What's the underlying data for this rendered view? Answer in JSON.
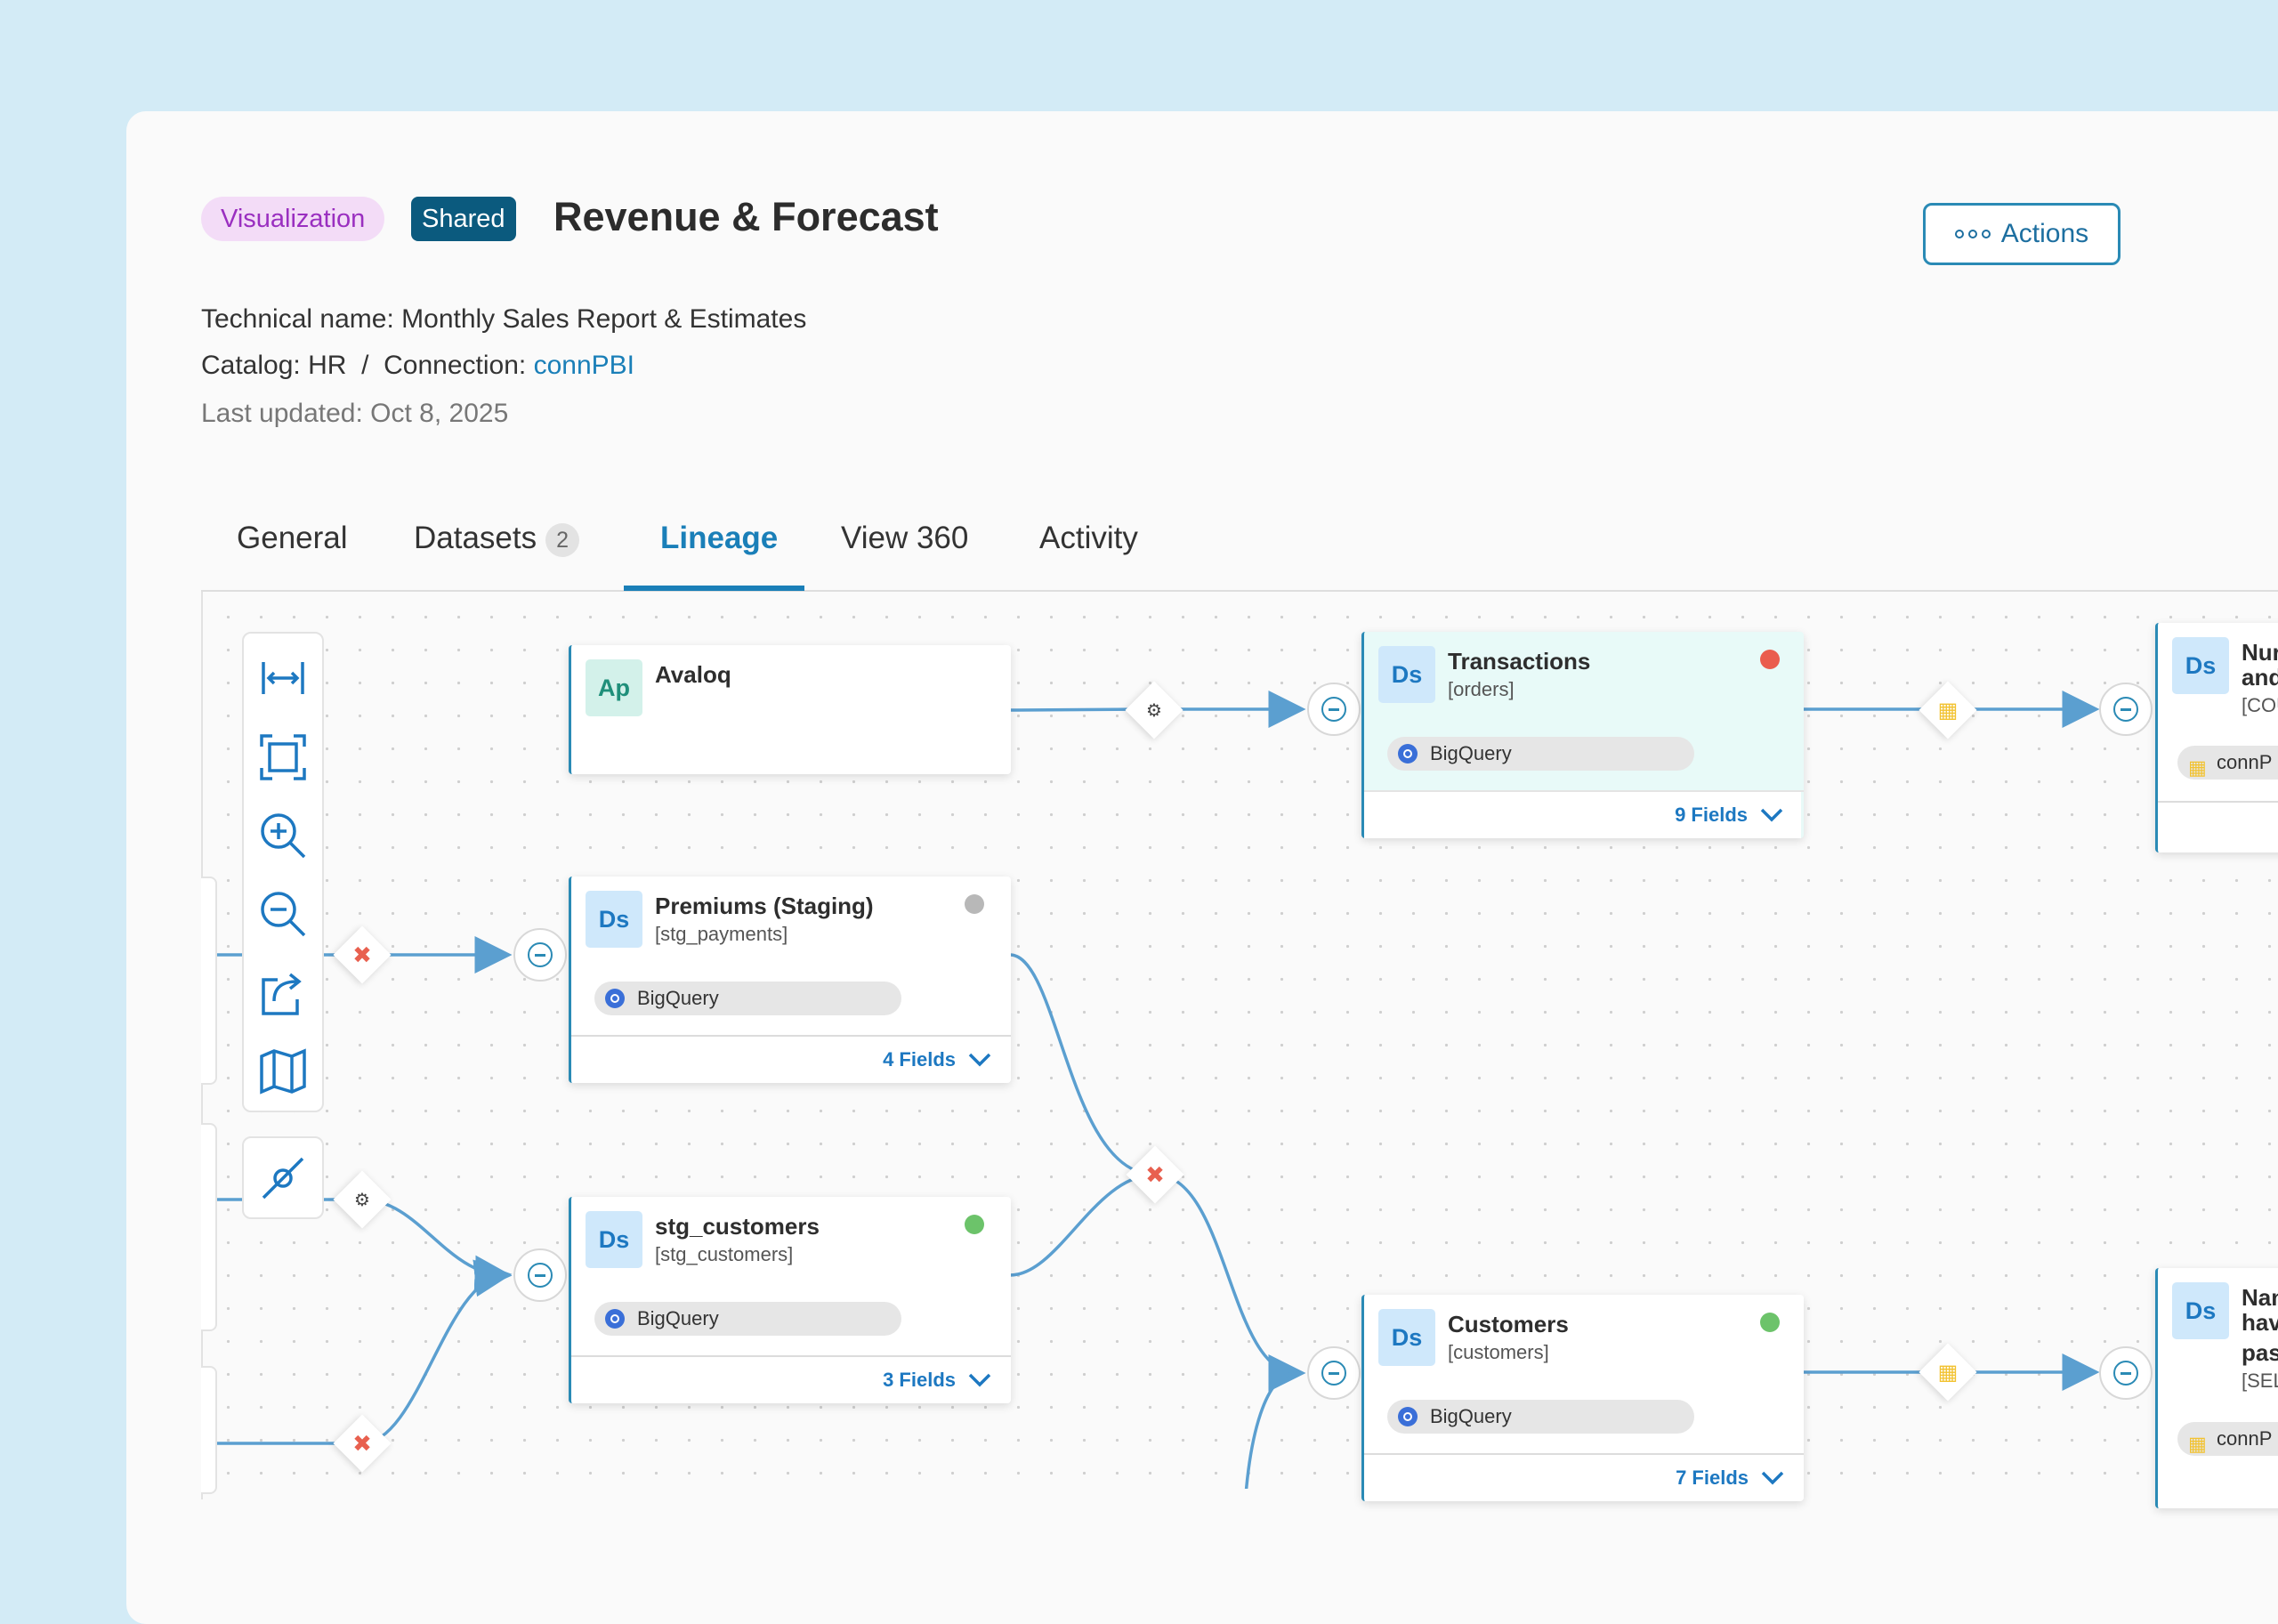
{
  "header": {
    "badge_type": "Visualization",
    "badge_shared": "Shared",
    "title": "Revenue & Forecast",
    "actions_label": "Actions"
  },
  "meta": {
    "technical_name_label": "Technical name:",
    "technical_name": "Monthly Sales Report & Estimates",
    "catalog_label": "Catalog:",
    "catalog": "HR",
    "separator": "/",
    "connection_label": "Connection:",
    "connection": "connPBI",
    "last_updated": "Last updated: Oct 8, 2025"
  },
  "tabs": [
    {
      "label": "General"
    },
    {
      "label": "Datasets",
      "count": "2"
    },
    {
      "label": "Lineage",
      "active": true
    },
    {
      "label": "View 360"
    },
    {
      "label": "Activity"
    }
  ],
  "toolbar": {
    "tools": [
      "fit-width-icon",
      "fit-screen-icon",
      "zoom-in-icon",
      "zoom-out-icon",
      "export-icon",
      "map-icon"
    ],
    "extra_tool": "link-tool-icon"
  },
  "nodes": {
    "avaloq": {
      "icon": "Ap",
      "name": "Avaloq"
    },
    "transactions": {
      "icon": "Ds",
      "name": "Transactions",
      "technical": "[orders]",
      "source": "BigQuery",
      "fields": "9 Fields",
      "status_color": "#ea5d4e"
    },
    "premiums": {
      "icon": "Ds",
      "name": "Premiums (Staging)",
      "technical": "[stg_payments]",
      "source": "BigQuery",
      "fields": "4 Fields",
      "status_color": "#b8b8b8"
    },
    "stg_customers": {
      "icon": "Ds",
      "name": "stg_customers",
      "technical": "[stg_customers]",
      "source": "BigQuery",
      "fields": "3 Fields",
      "status_color": "#6cc36a"
    },
    "customers": {
      "icon": "Ds",
      "name": "Customers",
      "technical": "[customers]",
      "source": "BigQuery",
      "fields": "7 Fields",
      "status_color": "#6cc36a"
    },
    "right_top": {
      "icon": "Ds",
      "name_1": "Nur",
      "name_2": "and",
      "technical": "[COU",
      "source": "connP"
    },
    "right_bottom": {
      "icon": "Ds",
      "name_1": "Nan",
      "name_2": "hav",
      "name_3": "pas",
      "technical": "[SEL",
      "source": "connP"
    }
  },
  "colors": {
    "accent": "#1a7fb8",
    "edge": "#5b9fd0",
    "error_transform": "#e8604f",
    "powerbi": "#f2c230"
  }
}
